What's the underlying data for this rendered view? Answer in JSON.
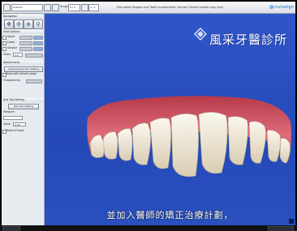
{
  "toolbar": {
    "view_dropdown": "Anterior",
    "stage_label": "Stage",
    "stage_value": "0 / 0",
    "step_value": "1 / 1",
    "window_title": "Simulated Stages and Tooth movements: Actual Clinical results may vary",
    "logo_text": "invisalign"
  },
  "panel": {
    "navigation_header": "Navigation",
    "view_options_header": "View Options",
    "upper_label": "Upper",
    "lower_label": "Lower",
    "gingiva_label": "Gingiva",
    "zoom_label": "Zoom",
    "zoom_value": "1.0",
    "attachments_header": "Attachments",
    "superimpose_label": "Superimpose Tool Setting",
    "show_label": "Show with details stage",
    "transparency_label": "Transparency",
    "tool_header": "Dist Tool Setting",
    "measure_label": "Measure",
    "value_label": "Value",
    "value_value": "0.00",
    "reset_button": "Reset all tools"
  },
  "viewport": {
    "watermark": "風采牙醫診所",
    "subtitle": "並加入醫師的矯正治療計劃，"
  },
  "colors": {
    "viewport_bg": "#2a4fc0",
    "gum": "#d85a6a",
    "teeth": "#efe7d6"
  }
}
